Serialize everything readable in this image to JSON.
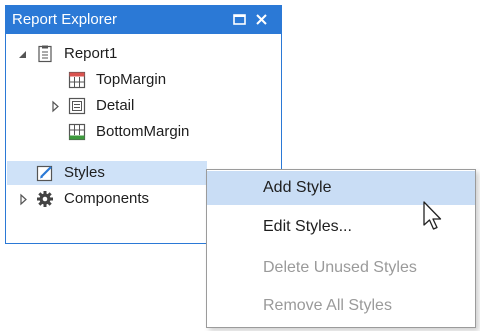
{
  "panel": {
    "title": "Report Explorer",
    "header_color": "#2b79d6"
  },
  "tree": {
    "report": {
      "label": "Report1",
      "icon": "report-icon",
      "expanded": true
    },
    "top_margin": {
      "label": "TopMargin",
      "icon": "top-margin-band-icon"
    },
    "detail": {
      "label": "Detail",
      "icon": "detail-band-icon",
      "expanded": false
    },
    "bottom_margin": {
      "label": "BottomMargin",
      "icon": "bottom-margin-band-icon"
    },
    "styles": {
      "label": "Styles",
      "icon": "styles-icon",
      "selected": true
    },
    "components": {
      "label": "Components",
      "icon": "gear-icon",
      "expanded": false
    }
  },
  "context_menu": {
    "items": [
      {
        "label": "Add Style",
        "enabled": true,
        "highlighted": true
      },
      {
        "label": "Edit Styles...",
        "enabled": true,
        "highlighted": false
      },
      {
        "label": "Delete Unused Styles",
        "enabled": false,
        "highlighted": false
      },
      {
        "label": "Remove All Styles",
        "enabled": false,
        "highlighted": false
      }
    ]
  },
  "colors": {
    "selection": "#cfe2f8",
    "menu_highlight": "#c9ddf5",
    "disabled_text": "#9a9a9a"
  }
}
